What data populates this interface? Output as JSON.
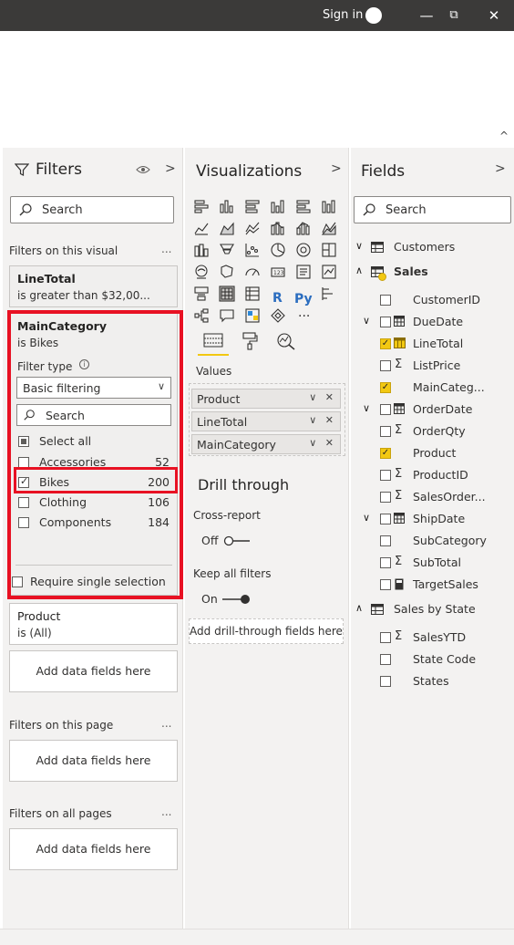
{
  "titlebar": {
    "signin_label": "Sign in",
    "minimize_glyph": "—",
    "restore_glyph": "⧉",
    "close_glyph": "✕"
  },
  "ribbon": {
    "collapse_glyph": "^"
  },
  "filters": {
    "title": "Filters",
    "search_placeholder": "Search",
    "section_visual": "Filters on this visual",
    "section_page": "Filters on this page",
    "section_all": "Filters on all pages",
    "more_glyph": "...",
    "cards": [
      {
        "name": "LineTotal",
        "desc": "is greater than $32,00..."
      },
      {
        "name": "MainCategory",
        "desc": "is Bikes"
      },
      {
        "name": "Product",
        "desc": "is (All)"
      }
    ],
    "filter_type_label": "Filter type",
    "filter_type_value": "Basic filtering",
    "inner_search_placeholder": "Search",
    "select_all": "Select all",
    "items": [
      {
        "label": "Accessories",
        "count": "52"
      },
      {
        "label": "Bikes",
        "count": "200"
      },
      {
        "label": "Clothing",
        "count": "106"
      },
      {
        "label": "Components",
        "count": "184"
      }
    ],
    "require_single": "Require single selection",
    "add_fields": "Add data fields here"
  },
  "viz": {
    "title": "Visualizations",
    "tabs_label_values": "Values",
    "wells": [
      "Product",
      "LineTotal",
      "MainCategory"
    ],
    "well_actions": "∨ ✕",
    "drill_title": "Drill through",
    "cross_report": "Cross-report",
    "cross_report_state": "Off",
    "keep_filters": "Keep all filters",
    "keep_filters_state": "On",
    "drill_drop": "Add drill-through fields here",
    "more_glyph": "···",
    "r_label": "R",
    "py_label": "Py"
  },
  "fields": {
    "title": "Fields",
    "search_placeholder": "Search",
    "sigma": "Σ",
    "tables": [
      {
        "name": "Customers"
      },
      {
        "name": "Sales"
      },
      {
        "name": "Sales by State"
      }
    ],
    "sales_fields": [
      "CustomerID",
      "DueDate",
      "LineTotal",
      "ListPrice",
      "MainCateg...",
      "OrderDate",
      "OrderQty",
      "Product",
      "ProductID",
      "SalesOrder...",
      "ShipDate",
      "SubCategory",
      "SubTotal",
      "TargetSales"
    ],
    "state_fields": [
      "SalesYTD",
      "State Code",
      "States"
    ]
  },
  "colors": {
    "accent_yellow": "#f2c811",
    "highlight_red": "#e81123",
    "titlebar": "#3b3a39"
  }
}
